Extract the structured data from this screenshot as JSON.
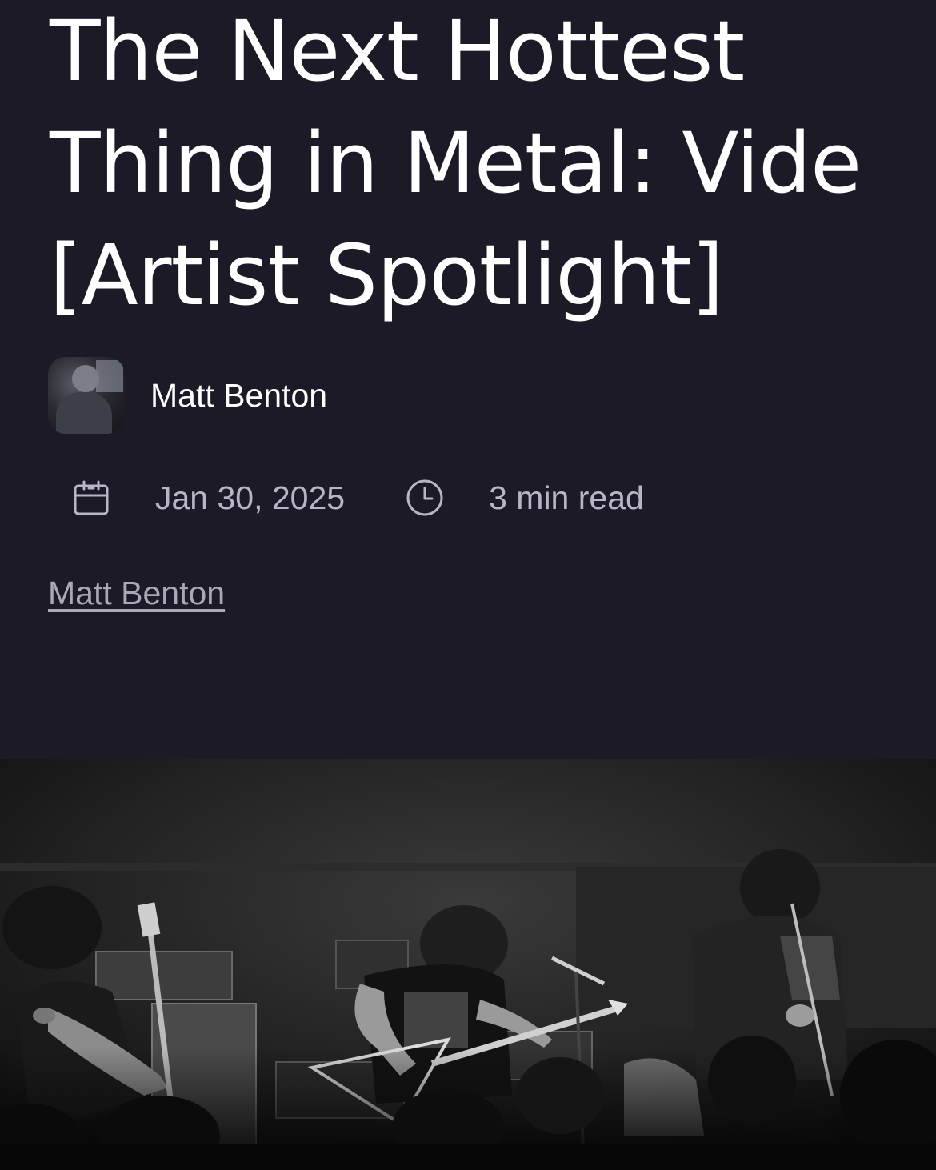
{
  "article": {
    "title": "The Next Hottest Thing in Metal: Vide [Artist Spotlight]",
    "author": {
      "name": "Matt Benton",
      "avatar_icon": "author-avatar"
    },
    "meta": {
      "date": "Jan 30, 2025",
      "date_icon": "calendar-icon",
      "read_time": "3 min read",
      "read_time_icon": "clock-icon"
    },
    "author_link": "Matt Benton",
    "hero_image": {
      "description_icon": "concert-photo"
    }
  },
  "colors": {
    "background": "#1b1a26",
    "title_text": "#ffffff",
    "meta_text": "#b8b6c4",
    "link_text": "#aaa8b6"
  }
}
